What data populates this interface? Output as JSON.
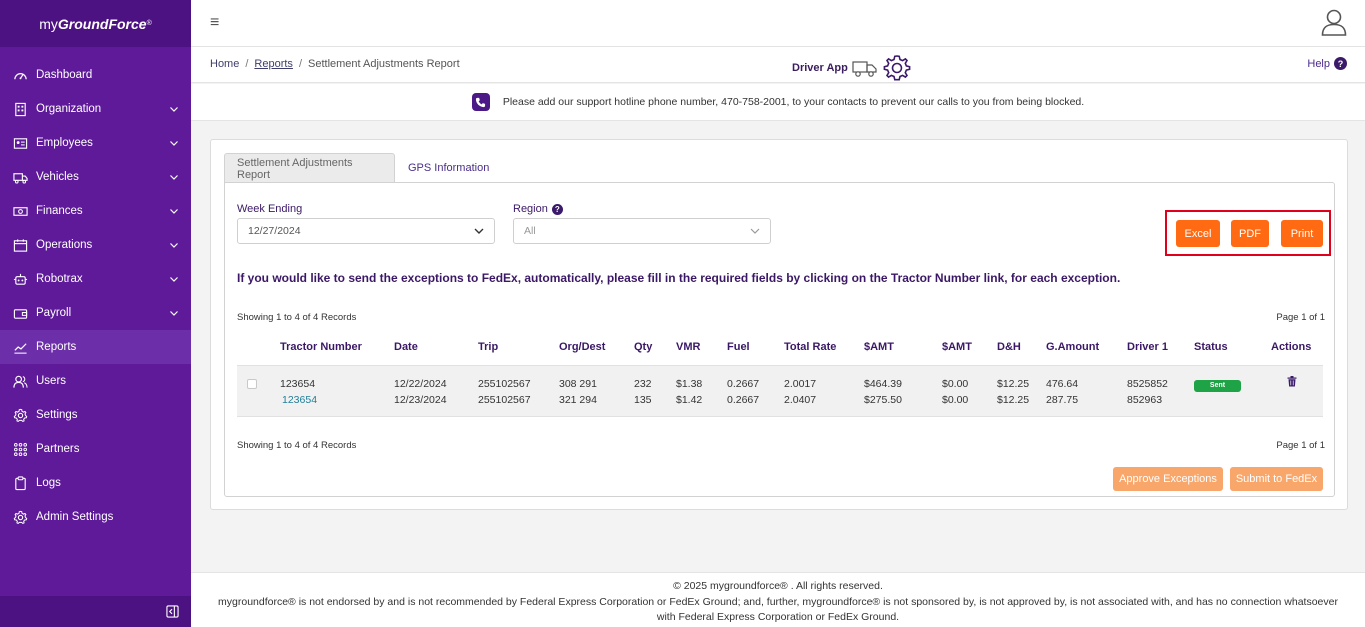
{
  "brand": {
    "prefix": "my",
    "bold": "GroundForce",
    "mark": "®"
  },
  "sidebar": {
    "items": [
      {
        "label": "Dashboard",
        "icon": "dashboard-icon",
        "chevron": false
      },
      {
        "label": "Organization",
        "icon": "building-icon",
        "chevron": true
      },
      {
        "label": "Employees",
        "icon": "id-card-icon",
        "chevron": true
      },
      {
        "label": "Vehicles",
        "icon": "truck-icon",
        "chevron": true
      },
      {
        "label": "Finances",
        "icon": "money-icon",
        "chevron": true
      },
      {
        "label": "Operations",
        "icon": "calendar-icon",
        "chevron": true
      },
      {
        "label": "Robotrax",
        "icon": "robot-icon",
        "chevron": true
      },
      {
        "label": "Payroll",
        "icon": "wallet-icon",
        "chevron": true
      },
      {
        "label": "Reports",
        "icon": "chart-icon",
        "chevron": false,
        "active": true
      },
      {
        "label": "Users",
        "icon": "users-icon",
        "chevron": false
      },
      {
        "label": "Settings",
        "icon": "gear-icon",
        "chevron": false
      },
      {
        "label": "Partners",
        "icon": "grid-icon",
        "chevron": false
      },
      {
        "label": "Logs",
        "icon": "clipboard-icon",
        "chevron": false
      },
      {
        "label": "Admin Settings",
        "icon": "admin-gear-icon",
        "chevron": false
      }
    ]
  },
  "header": {
    "hamburger": "≡"
  },
  "breadcrumb": {
    "home": "Home",
    "sep": "/",
    "reports": "Reports",
    "current": "Settlement Adjustments Report"
  },
  "driver_app": "Driver App",
  "help": {
    "label": "Help",
    "q": "?"
  },
  "notice": "Please add our support hotline phone number, 470-758-2001, to your contacts to prevent our calls to you from being blocked.",
  "tabs": [
    {
      "label": "Settlement Adjustments Report",
      "active": true
    },
    {
      "label": "GPS Information",
      "active": false
    }
  ],
  "filters": {
    "week_label": "Week Ending",
    "week_value": "12/27/2024",
    "region_label": "Region",
    "region_value": "All",
    "q": "?"
  },
  "exports": {
    "excel": "Excel",
    "pdf": "PDF",
    "print": "Print"
  },
  "instruction": "If you would like to send the exceptions to FedEx, automatically, please fill in the required fields by clicking on the Tractor Number link, for each exception.",
  "records_text": "Showing 1 to 4 of 4 Records",
  "page_text": "Page 1 of 1",
  "table": {
    "columns": [
      "",
      "Tractor Number",
      "Date",
      "Trip",
      "Org/Dest",
      "Qty",
      "VMR",
      "Fuel",
      "Total Rate",
      "$AMT",
      "$AMT",
      "D&H",
      "G.Amount",
      "Driver 1",
      "Status",
      "Actions"
    ],
    "row": {
      "tractor": [
        "123654",
        "123654"
      ],
      "date": [
        "12/22/2024",
        "12/23/2024"
      ],
      "trip": [
        "255102567",
        "255102567"
      ],
      "orgdest": [
        "308 291",
        "321 294"
      ],
      "qty": [
        "232",
        "135"
      ],
      "vmr": [
        "$1.38",
        "$1.42"
      ],
      "fuel": [
        "0.2667",
        "0.2667"
      ],
      "total_rate": [
        "2.0017",
        "2.0407"
      ],
      "amt1": [
        "$464.39",
        "$275.50"
      ],
      "amt2": [
        "$0.00",
        "$0.00"
      ],
      "dh": [
        "$12.25",
        "$12.25"
      ],
      "gamount": [
        "476.64",
        "287.75"
      ],
      "driver1": [
        "8525852",
        "852963"
      ],
      "status": "Sent"
    }
  },
  "actions": {
    "approve": "Approve Exceptions",
    "submit": "Submit to FedEx"
  },
  "footer": {
    "line1": "© 2025 mygroundforce® . All rights reserved.",
    "line2": "mygroundforce® is not endorsed by and is not recommended by Federal Express Corporation or FedEx Ground; and, further, mygroundforce® is not sponsored by, is not approved by, is not associated with, and has no connection whatsoever",
    "line3": "with Federal Express Corporation or FedEx Ground."
  },
  "colors": {
    "sidebar": "#5e1a99",
    "accent": "#ff6a13",
    "status_green": "#1fa347",
    "highlight": "#e0001b"
  }
}
